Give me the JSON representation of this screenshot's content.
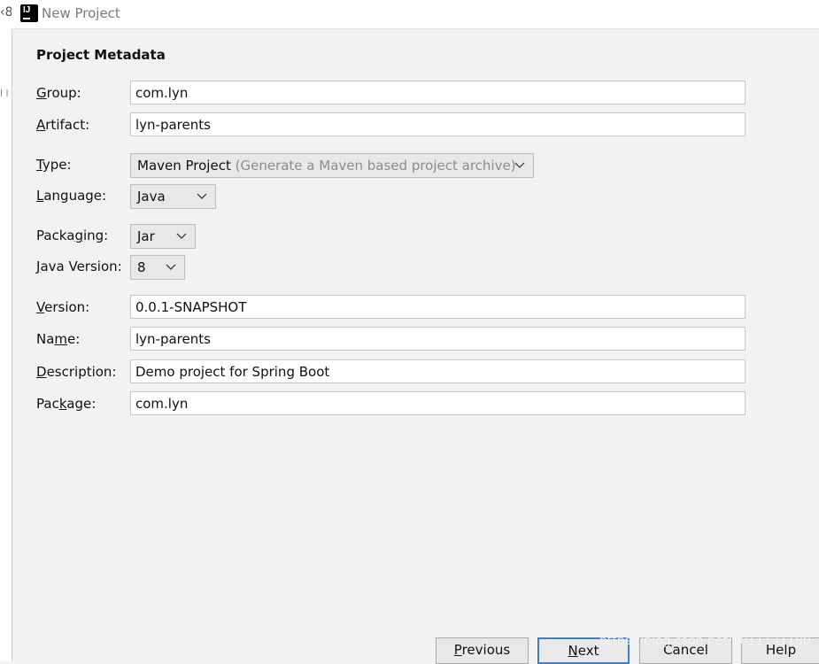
{
  "window": {
    "title": "New Project"
  },
  "background": {
    "fragment1": "‹8",
    "fragment2": "l l"
  },
  "section": {
    "title": "Project Metadata"
  },
  "form": {
    "group": {
      "label_u": "G",
      "label_rest": "roup:",
      "value": "com.lyn"
    },
    "artifact": {
      "label_u": "A",
      "label_rest": "rtifact:",
      "value": "lyn-parents"
    },
    "type": {
      "label_u": "T",
      "label_rest": "ype:",
      "value": "Maven Project",
      "hint": "(Generate a Maven based project archive)"
    },
    "language": {
      "label_pre": "",
      "label_u": "L",
      "label_rest": "anguage:",
      "value": "Java"
    },
    "packaging": {
      "label_pre": "Packa",
      "label_u": "g",
      "label_rest": "ing:",
      "value": "Jar"
    },
    "java_version": {
      "label_u": "J",
      "label_rest": "ava Version:",
      "value": "8"
    },
    "version": {
      "label_u": "V",
      "label_rest": "ersion:",
      "value": "0.0.1-SNAPSHOT"
    },
    "name": {
      "label_pre": "Na",
      "label_u": "m",
      "label_rest": "e:",
      "value": "lyn-parents"
    },
    "description": {
      "label_u": "D",
      "label_rest": "escription:",
      "value": "Demo project for Spring Boot"
    },
    "package": {
      "label_pre": "Pac",
      "label_u": "k",
      "label_rest": "age:",
      "value": "com.lyn"
    }
  },
  "buttons": {
    "previous": {
      "u": "P",
      "rest": "revious"
    },
    "next": {
      "u": "N",
      "rest": "ext"
    },
    "cancel": {
      "label": "Cancel"
    },
    "help": {
      "label": "Help"
    }
  },
  "watermark": "https://blog.csdn.net/u011131180",
  "colors": {
    "accent": "#3c7fd1",
    "background": "#f2f2f2"
  }
}
